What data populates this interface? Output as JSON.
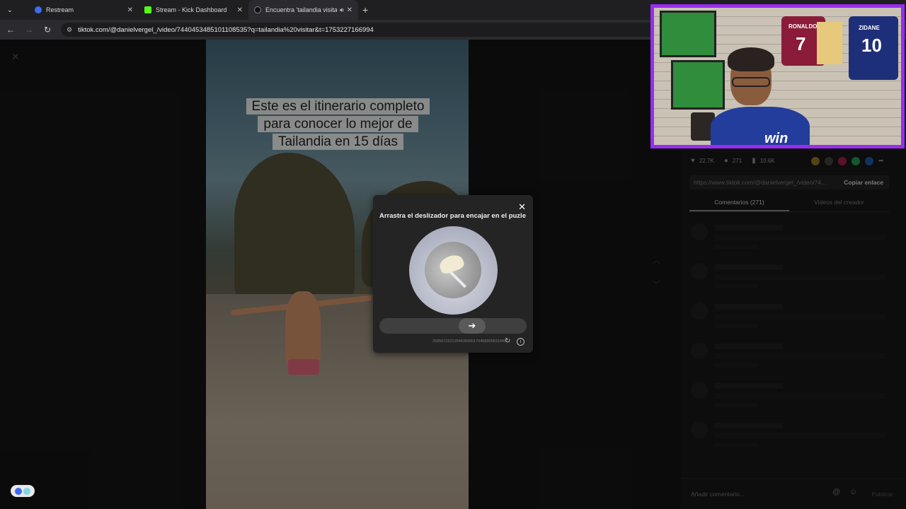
{
  "browser": {
    "tabs": [
      {
        "title": "Restream",
        "favicon_color": "#3d6cf0",
        "favicon_letter": "R",
        "active": false
      },
      {
        "title": "Stream - Kick Dashboard",
        "favicon_color": "#53fc18",
        "favicon_letter": "K",
        "active": false
      },
      {
        "title": "Encuentra 'tailandia visitar'",
        "favicon_color": "#111111",
        "favicon_letter": "♪",
        "active": true
      }
    ],
    "new_tab_label": "+",
    "url": "tiktok.com/@danielvergel_/video/7440453485101108535?q=tailandia%20visitar&t=1753227166994"
  },
  "video": {
    "caption_lines": [
      "Este es el itinerario completo",
      "para conocer lo mejor de",
      "Tailandia en 15 días"
    ]
  },
  "captcha": {
    "prompt": "Arrastra el deslizador para encajar en el puzle",
    "footer_code": "2025072221254439900170468905831848",
    "close_icon": "close-icon",
    "slider_icon": "arrow-right-icon"
  },
  "side_panel": {
    "stats": {
      "likes": "22.7K",
      "comments": "271",
      "saves": "10.6K"
    },
    "share_colors": [
      "#c9a227",
      "#3a3a3a",
      "#e0245e",
      "#25d366",
      "#1877f2"
    ],
    "link": "https://www.tiktok.com/@danielvergel_/video/74...",
    "copy_label": "Copiar enlace",
    "tabs": [
      "Comentarios (271)",
      "Videos del creador"
    ],
    "comment_placeholder": "Añadir comentario...",
    "publish_label": "Publicar"
  },
  "webcam": {
    "jerseys": [
      {
        "name": "RONALDO",
        "number": "7",
        "color": "#8a1c3a"
      },
      {
        "name": "ZIDANE",
        "number": "10",
        "color": "#1e2f7a"
      }
    ],
    "shirt_text": "win"
  },
  "colors": {
    "cam_border": "#9a2cf2",
    "accent": "#53fc18"
  }
}
